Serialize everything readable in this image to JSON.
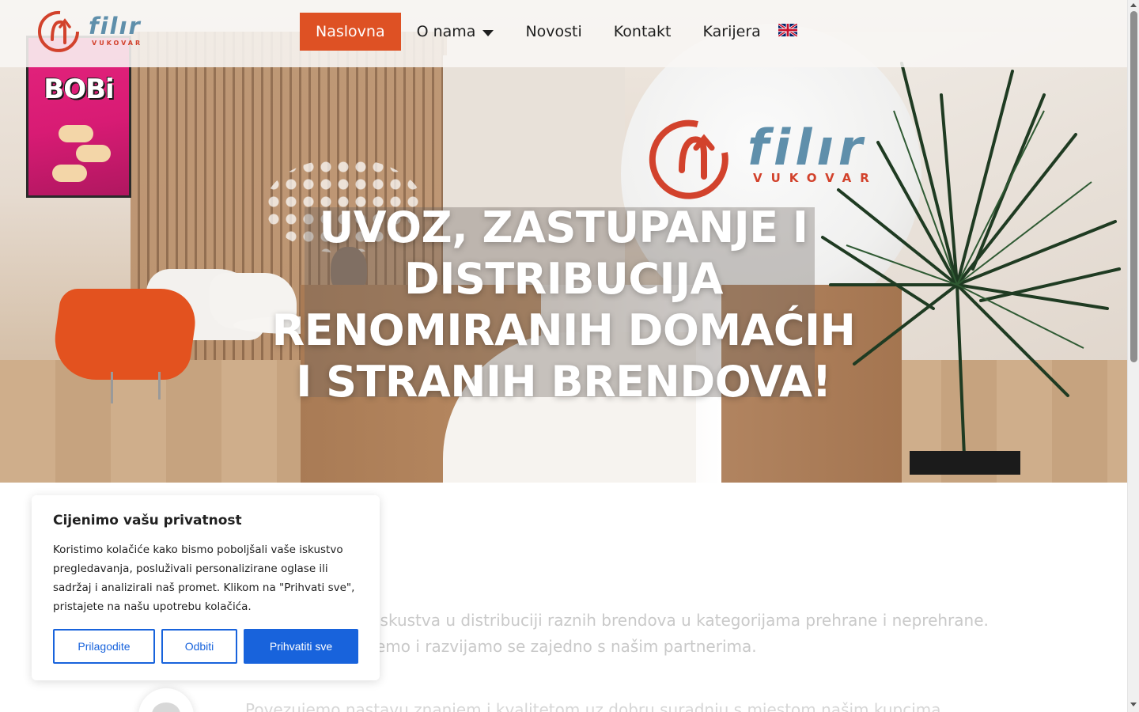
{
  "header": {
    "logo_text": "filır",
    "logo_sub": "VUKOVAR",
    "nav": [
      {
        "label": "Naslovna",
        "active": true
      },
      {
        "label": "O nama",
        "has_dropdown": true
      },
      {
        "label": "Novosti"
      },
      {
        "label": "Kontakt"
      },
      {
        "label": "Karijera"
      }
    ],
    "language_icon": "uk-flag-icon"
  },
  "hero": {
    "title": "UVOZ, ZASTUPANJE I DISTRIBUCIJA RENOMIRANIH DOMAĆIH I STRANIH BRENDOVA!",
    "sign_logo_text": "filır",
    "sign_logo_sub": "VUKOVAR",
    "poster_text": "BOBi"
  },
  "intro": {
    "line1": "iskustva u distribuciji raznih brendova u kategorijama prehrane i neprehrane.",
    "line2": "emo i razvijamo se zajedno s našim partnerima."
  },
  "service": {
    "partial_text": "Povezujemo nastavu znanjem i kvalitetom uz dobru suradnju s mjestom našim kupcima"
  },
  "cookie_banner": {
    "title": "Cijenimo vašu privatnost",
    "text": "Koristimo kolačiće kako bismo poboljšali vaše iskustvo pregledavanja, posluživali personalizirane oglase ili sadržaj i analizirali naš promet. Klikom na \"Prihvati sve\", pristajete na našu upotrebu kolačića.",
    "customize_label": "Prilagodite",
    "reject_label": "Odbiti",
    "accept_label": "Prihvatiti sve"
  },
  "colors": {
    "accent": "#de5124",
    "brand_blue": "#5f8fab",
    "brand_red": "#d2422c",
    "cookie_blue": "#1863dc"
  }
}
